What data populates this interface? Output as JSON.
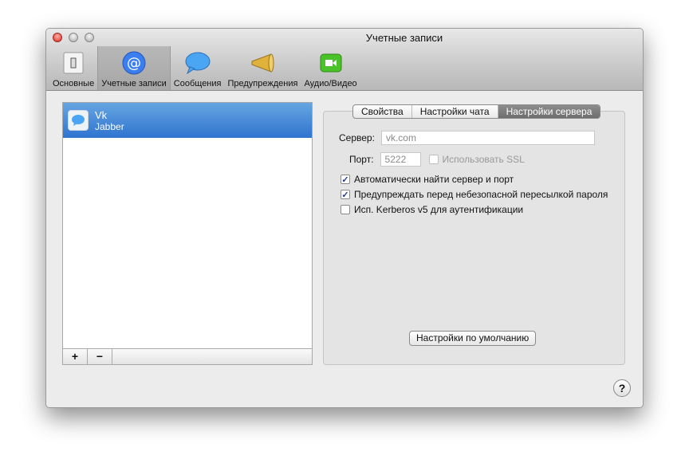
{
  "window": {
    "title": "Учетные записи"
  },
  "toolbar": [
    {
      "label": "Основные",
      "icon": "switch-icon"
    },
    {
      "label": "Учетные записи",
      "icon": "at-icon"
    },
    {
      "label": "Сообщения",
      "icon": "speech-bubble-icon"
    },
    {
      "label": "Предупреждения",
      "icon": "megaphone-icon"
    },
    {
      "label": "Аудио/Видео",
      "icon": "video-camera-icon"
    }
  ],
  "accounts": [
    {
      "name": "Vk",
      "type": "Jabber"
    }
  ],
  "list_buttons": {
    "add": "+",
    "remove": "−"
  },
  "tabs": [
    "Свойства",
    "Настройки чата",
    "Настройки сервера"
  ],
  "server": {
    "server_label": "Сервер:",
    "server_value": "vk.com",
    "port_label": "Порт:",
    "port_value": "5222",
    "ssl_label": "Использовать SSL",
    "opt_auto": "Автоматически найти сервер и порт",
    "opt_warn": "Предупреждать перед небезопасной пересылкой пароля",
    "opt_kerberos": "Исп. Kerberos v5 для аутентификации"
  },
  "defaults_button": "Настройки по умолчанию",
  "help": "?"
}
